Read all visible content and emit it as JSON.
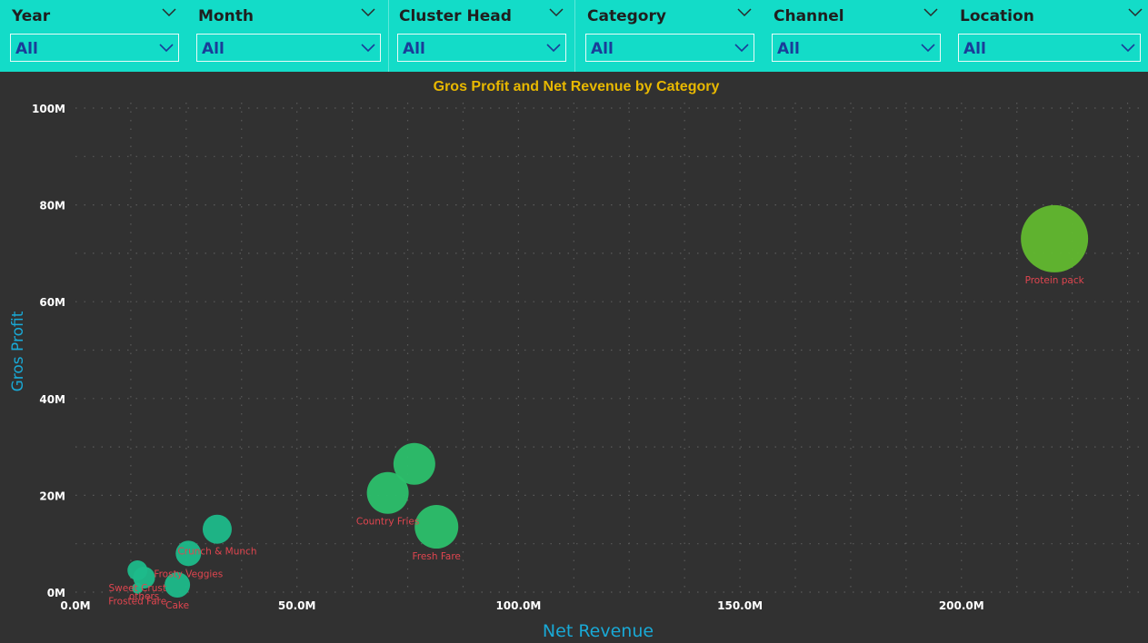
{
  "filters": [
    {
      "title": "Year",
      "value": "All"
    },
    {
      "title": "Month",
      "value": "All"
    },
    {
      "title": "Cluster Head",
      "value": "All"
    },
    {
      "title": "Category",
      "value": "All"
    },
    {
      "title": "Channel",
      "value": "All"
    },
    {
      "title": "Location",
      "value": "All"
    }
  ],
  "colors": {
    "filter_bar": "#13dcc8",
    "filter_value": "#1a3d99",
    "background": "#313131",
    "title": "#e8b800",
    "axis_title": "#19a9d6",
    "tick_label": "#ffffff",
    "data_label": "#e0454f",
    "bubble_teal": "#1dbb8a",
    "bubble_green": "#2cc06c",
    "bubble_lime": "#62b92f"
  },
  "chart_data": {
    "type": "scatter",
    "title": "Gros Profit and Net Revenue by Category",
    "xlabel": "Net Revenue",
    "ylabel": "Gros Profit",
    "xlim": [
      0,
      230
    ],
    "ylim": [
      0,
      100
    ],
    "xticks": [
      "0.0M",
      "50.0M",
      "100.0M",
      "150.0M",
      "200.0M"
    ],
    "xtick_values": [
      0,
      50,
      100,
      150,
      200
    ],
    "yticks": [
      "0M",
      "20M",
      "40M",
      "60M",
      "80M",
      "100M"
    ],
    "ytick_values": [
      0,
      20,
      40,
      60,
      80,
      100
    ],
    "grid": true,
    "points": [
      {
        "label": "Protein pack",
        "x": 221,
        "y": 73,
        "size": 3.7,
        "color": "bubble_lime"
      },
      {
        "label": "",
        "x": 76.5,
        "y": 26.5,
        "size": 2.3,
        "color": "bubble_green"
      },
      {
        "label": "Country Fries",
        "x": 70.5,
        "y": 20.5,
        "size": 2.3,
        "color": "bubble_green"
      },
      {
        "label": "Fresh Fare",
        "x": 81.5,
        "y": 13.5,
        "size": 2.4,
        "color": "bubble_green"
      },
      {
        "label": "Crunch & Munch",
        "x": 32,
        "y": 13,
        "size": 1.6,
        "color": "bubble_teal"
      },
      {
        "label": "Frosty Veggies",
        "x": 25.5,
        "y": 8,
        "size": 1.4,
        "color": "bubble_teal"
      },
      {
        "label": "Sweet Crust",
        "x": 14,
        "y": 4.5,
        "size": 1.1,
        "color": "bubble_teal"
      },
      {
        "label": "others",
        "x": 15.5,
        "y": 3,
        "size": 1.2,
        "color": "bubble_teal"
      },
      {
        "label": "Cake",
        "x": 23,
        "y": 1.5,
        "size": 1.4,
        "color": "bubble_teal"
      },
      {
        "label": "Frosted Fare",
        "x": 14,
        "y": 0.8,
        "size": 0.6,
        "color": "bubble_teal"
      }
    ]
  }
}
